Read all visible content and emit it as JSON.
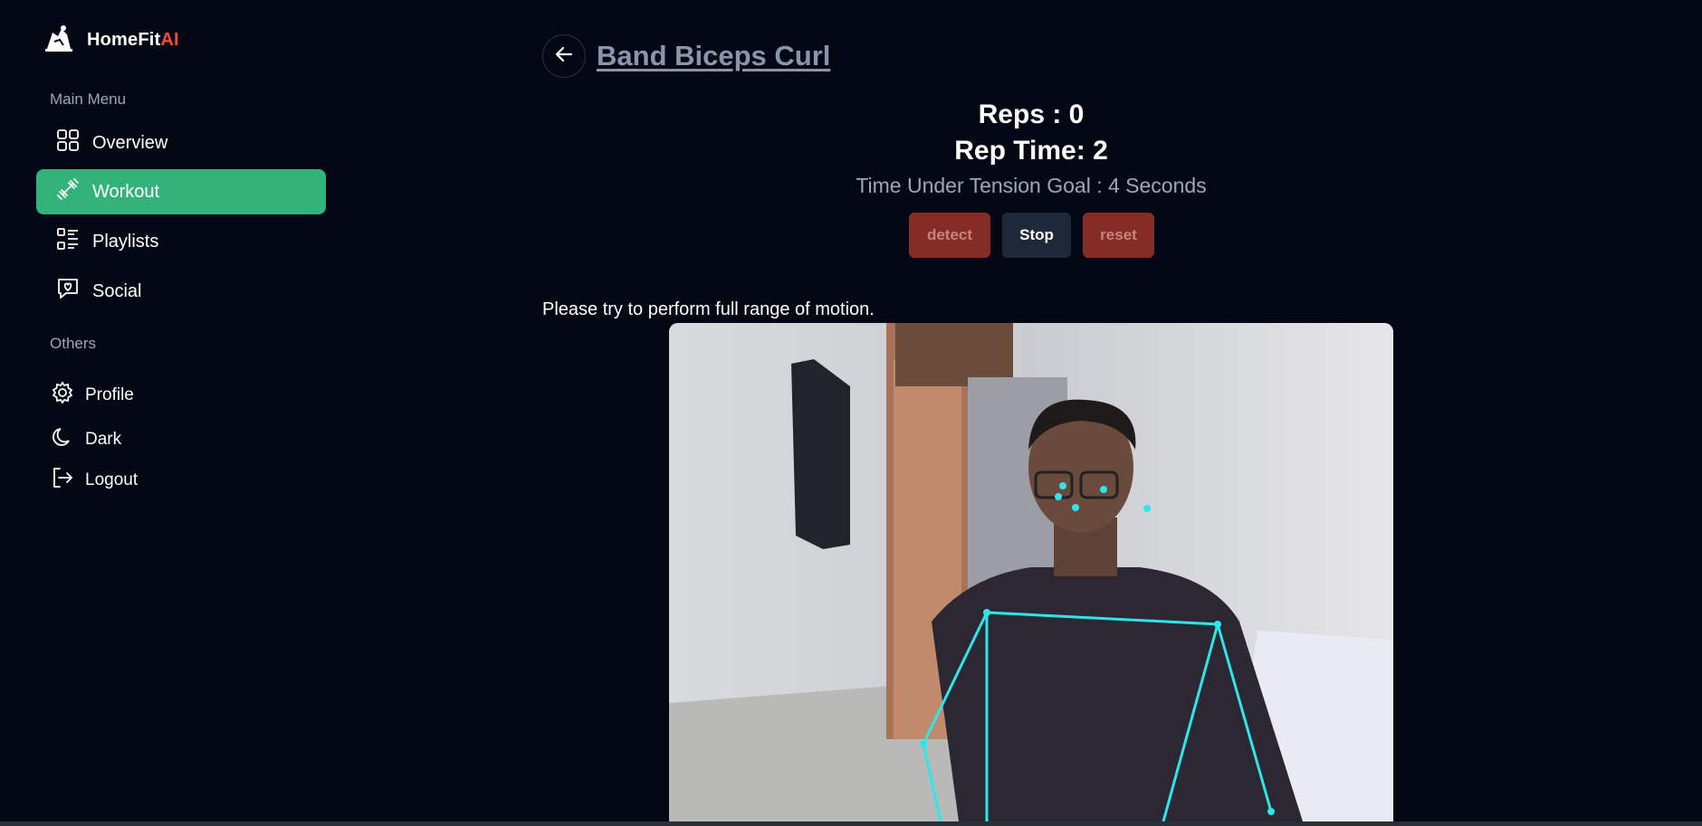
{
  "app": {
    "name_prefix": "HomeFit",
    "name_suffix": "AI",
    "brand_accent": "#ef4a3c"
  },
  "sidebar": {
    "main_menu_label": "Main Menu",
    "items": [
      {
        "label": "Overview",
        "icon": "grid-icon"
      },
      {
        "label": "Workout",
        "icon": "dumbbell-icon",
        "active": true
      },
      {
        "label": "Playlists",
        "icon": "list-icon"
      },
      {
        "label": "Social",
        "icon": "chat-heart-icon"
      }
    ],
    "others_label": "Others",
    "others": [
      {
        "label": "Profile",
        "icon": "gear-icon"
      },
      {
        "label": "Dark",
        "icon": "moon-icon"
      },
      {
        "label": "Logout",
        "icon": "logout-icon"
      }
    ],
    "active_color": "#33b27a"
  },
  "exercise": {
    "title": "Band Biceps Curl",
    "reps_text": "Reps : 0",
    "rep_time_text": "Rep Time: 2",
    "tut_goal_text": "Time Under Tension Goal : 4 Seconds",
    "instruction": "Please try to perform full range of motion."
  },
  "controls": {
    "detect_label": "detect",
    "stop_label": "Stop",
    "reset_label": "reset",
    "danger_color": "#842c25"
  },
  "pose_overlay_color": "#2ee6ea"
}
